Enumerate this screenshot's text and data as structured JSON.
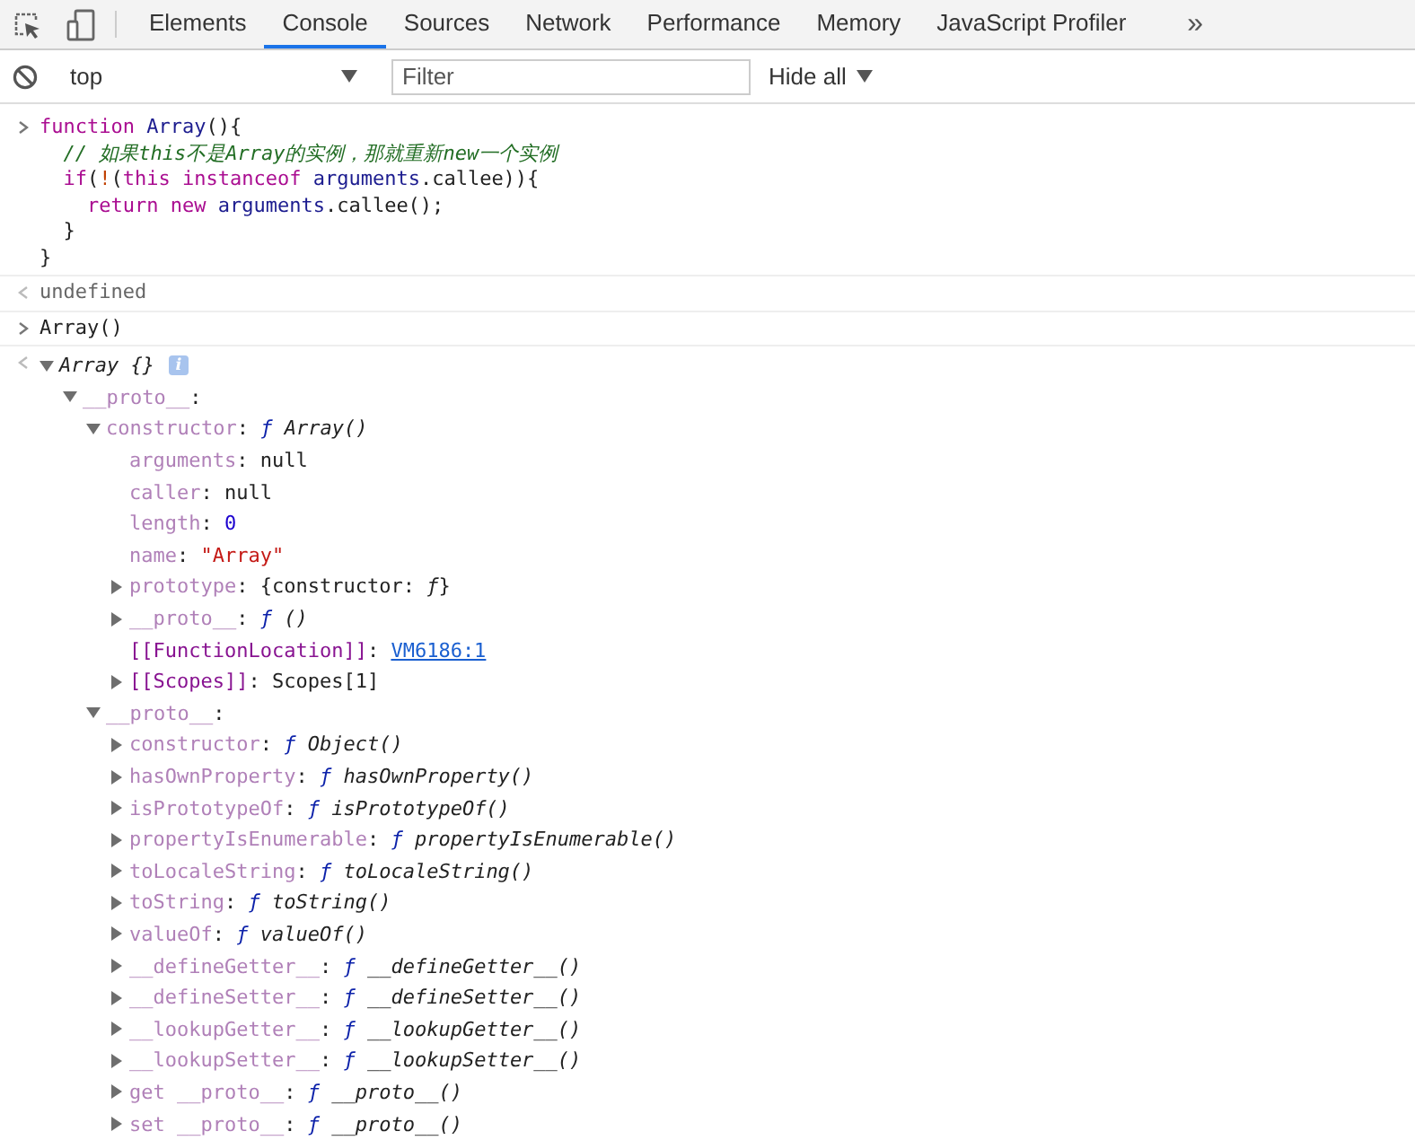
{
  "tabs": [
    {
      "label": "Elements",
      "selected": false
    },
    {
      "label": "Console",
      "selected": true
    },
    {
      "label": "Sources",
      "selected": false
    },
    {
      "label": "Network",
      "selected": false
    },
    {
      "label": "Performance",
      "selected": false
    },
    {
      "label": "Memory",
      "selected": false
    },
    {
      "label": "JavaScript Profiler",
      "selected": false
    }
  ],
  "overflow": "»",
  "toolbar": {
    "context": "top",
    "filter_placeholder": "Filter",
    "levels": "Hide all"
  },
  "console": [
    {
      "kind": "input",
      "lines": [
        [
          {
            "kind": "keyword",
            "text": "function "
          },
          {
            "kind": "name",
            "text": "Array"
          },
          {
            "kind": "plain",
            "text": "(){"
          }
        ],
        [
          {
            "kind": "comment",
            "text": "  // 如果this不是Array的实例，那就重新new一个实例"
          }
        ],
        [
          {
            "kind": "keyword",
            "text": "  if"
          },
          {
            "kind": "plain",
            "text": "("
          },
          {
            "kind": "operator",
            "text": "!"
          },
          {
            "kind": "plain",
            "text": "("
          },
          {
            "kind": "keyword",
            "text": "this instanceof "
          },
          {
            "kind": "name",
            "text": "arguments"
          },
          {
            "kind": "plain",
            "text": ".callee)){"
          }
        ],
        [
          {
            "kind": "keyword",
            "text": "    return new "
          },
          {
            "kind": "name",
            "text": "arguments"
          },
          {
            "kind": "plain",
            "text": ".callee();"
          }
        ],
        [
          {
            "kind": "plain",
            "text": "  }"
          }
        ],
        [
          {
            "kind": "plain",
            "text": "}"
          }
        ]
      ]
    },
    {
      "kind": "result",
      "text": "undefined"
    },
    {
      "kind": "input",
      "lines": [
        [
          {
            "kind": "plain",
            "text": "Array()"
          }
        ]
      ]
    },
    {
      "kind": "object",
      "label": "Array {}",
      "expanded": true,
      "info": "i",
      "children": [
        {
          "key": "__proto__:",
          "dim": true,
          "expanded": true,
          "children": [
            {
              "key": "constructor:",
              "dim": true,
              "expanded": true,
              "value": [
                {
                  "kind": "fn",
                  "text": "ƒ "
                },
                {
                  "kind": "italic",
                  "text": "Array()"
                }
              ],
              "children": [
                {
                  "key": "arguments:",
                  "dim": true,
                  "value": [
                    {
                      "kind": "plain",
                      "text": "null"
                    }
                  ]
                },
                {
                  "key": "caller:",
                  "dim": true,
                  "value": [
                    {
                      "kind": "plain",
                      "text": "null"
                    }
                  ]
                },
                {
                  "key": "length:",
                  "dim": true,
                  "value": [
                    {
                      "kind": "number",
                      "text": "0"
                    }
                  ]
                },
                {
                  "key": "name:",
                  "dim": true,
                  "value": [
                    {
                      "kind": "string",
                      "text": "\"Array\""
                    }
                  ]
                },
                {
                  "key": "prototype:",
                  "dim": true,
                  "expanded": false,
                  "value": [
                    {
                      "kind": "plain",
                      "text": "{constructor: "
                    },
                    {
                      "kind": "italic",
                      "text": "ƒ"
                    },
                    {
                      "kind": "plain",
                      "text": "}"
                    }
                  ]
                },
                {
                  "key": "__proto__:",
                  "dim": true,
                  "expanded": false,
                  "value": [
                    {
                      "kind": "fn",
                      "text": "ƒ "
                    },
                    {
                      "kind": "italic",
                      "text": "()"
                    }
                  ]
                },
                {
                  "key": "[[FunctionLocation]]:",
                  "dim": false,
                  "value": [
                    {
                      "kind": "link",
                      "text": "VM6186:1"
                    }
                  ]
                },
                {
                  "key": "[[Scopes]]:",
                  "dim": false,
                  "expanded": false,
                  "value": [
                    {
                      "kind": "plain",
                      "text": "Scopes[1]"
                    }
                  ]
                }
              ]
            },
            {
              "key": "__proto__:",
              "dim": true,
              "expanded": true,
              "children": [
                {
                  "key": "constructor:",
                  "dim": true,
                  "expanded": false,
                  "value": [
                    {
                      "kind": "fn",
                      "text": "ƒ "
                    },
                    {
                      "kind": "italic",
                      "text": "Object()"
                    }
                  ]
                },
                {
                  "key": "hasOwnProperty:",
                  "dim": true,
                  "expanded": false,
                  "value": [
                    {
                      "kind": "fn",
                      "text": "ƒ "
                    },
                    {
                      "kind": "italic",
                      "text": "hasOwnProperty()"
                    }
                  ]
                },
                {
                  "key": "isPrototypeOf:",
                  "dim": true,
                  "expanded": false,
                  "value": [
                    {
                      "kind": "fn",
                      "text": "ƒ "
                    },
                    {
                      "kind": "italic",
                      "text": "isPrototypeOf()"
                    }
                  ]
                },
                {
                  "key": "propertyIsEnumerable:",
                  "dim": true,
                  "expanded": false,
                  "value": [
                    {
                      "kind": "fn",
                      "text": "ƒ "
                    },
                    {
                      "kind": "italic",
                      "text": "propertyIsEnumerable()"
                    }
                  ]
                },
                {
                  "key": "toLocaleString:",
                  "dim": true,
                  "expanded": false,
                  "value": [
                    {
                      "kind": "fn",
                      "text": "ƒ "
                    },
                    {
                      "kind": "italic",
                      "text": "toLocaleString()"
                    }
                  ]
                },
                {
                  "key": "toString:",
                  "dim": true,
                  "expanded": false,
                  "value": [
                    {
                      "kind": "fn",
                      "text": "ƒ "
                    },
                    {
                      "kind": "italic",
                      "text": "toString()"
                    }
                  ]
                },
                {
                  "key": "valueOf:",
                  "dim": true,
                  "expanded": false,
                  "value": [
                    {
                      "kind": "fn",
                      "text": "ƒ "
                    },
                    {
                      "kind": "italic",
                      "text": "valueOf()"
                    }
                  ]
                },
                {
                  "key": "__defineGetter__:",
                  "dim": true,
                  "expanded": false,
                  "value": [
                    {
                      "kind": "fn",
                      "text": "ƒ "
                    },
                    {
                      "kind": "italic",
                      "text": "__defineGetter__()"
                    }
                  ]
                },
                {
                  "key": "__defineSetter__:",
                  "dim": true,
                  "expanded": false,
                  "value": [
                    {
                      "kind": "fn",
                      "text": "ƒ "
                    },
                    {
                      "kind": "italic",
                      "text": "__defineSetter__()"
                    }
                  ]
                },
                {
                  "key": "__lookupGetter__:",
                  "dim": true,
                  "expanded": false,
                  "value": [
                    {
                      "kind": "fn",
                      "text": "ƒ "
                    },
                    {
                      "kind": "italic",
                      "text": "__lookupGetter__()"
                    }
                  ]
                },
                {
                  "key": "__lookupSetter__:",
                  "dim": true,
                  "expanded": false,
                  "value": [
                    {
                      "kind": "fn",
                      "text": "ƒ "
                    },
                    {
                      "kind": "italic",
                      "text": "__lookupSetter__()"
                    }
                  ]
                },
                {
                  "key": "get __proto__:",
                  "dim": true,
                  "expanded": false,
                  "value": [
                    {
                      "kind": "fn",
                      "text": "ƒ "
                    },
                    {
                      "kind": "italic",
                      "text": "__proto__()"
                    }
                  ]
                },
                {
                  "key": "set __proto__:",
                  "dim": true,
                  "expanded": false,
                  "value": [
                    {
                      "kind": "fn",
                      "text": "ƒ "
                    },
                    {
                      "kind": "italic",
                      "text": "__proto__()"
                    }
                  ]
                }
              ]
            }
          ]
        }
      ]
    }
  ]
}
